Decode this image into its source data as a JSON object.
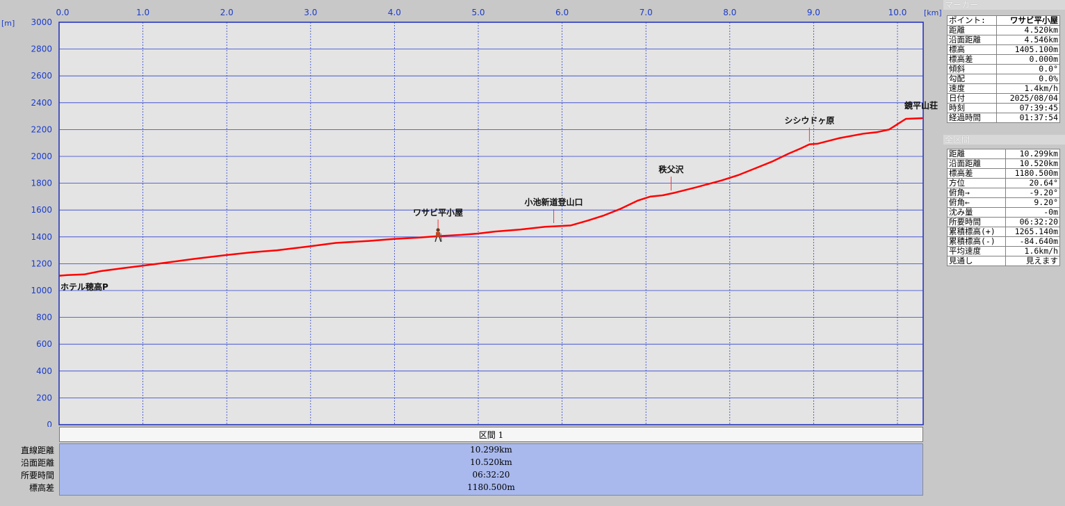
{
  "chart_data": {
    "type": "line",
    "x_unit": "[km]",
    "y_unit": "[m]",
    "xlim": [
      0,
      10.3
    ],
    "ylim": [
      0,
      3000
    ],
    "x_ticks": [
      "0.0",
      "1.0",
      "2.0",
      "3.0",
      "4.0",
      "5.0",
      "6.0",
      "7.0",
      "8.0",
      "9.0",
      "10.0"
    ],
    "y_ticks": [
      "0",
      "200",
      "400",
      "600",
      "800",
      "1000",
      "1200",
      "1400",
      "1600",
      "1800",
      "2000",
      "2200",
      "2400",
      "2600",
      "2800",
      "3000"
    ],
    "grid": true,
    "line_color": "#ff0000",
    "series": [
      {
        "x": [
          0.0,
          0.1,
          0.3,
          0.5,
          0.8,
          1.0,
          1.3,
          1.6,
          2.0,
          2.3,
          2.6,
          3.0,
          3.3,
          3.7,
          4.0,
          4.3,
          4.52,
          4.8,
          5.0,
          5.2,
          5.5,
          5.8,
          5.95,
          6.1,
          6.3,
          6.5,
          6.7,
          6.9,
          7.05,
          7.2,
          7.35,
          7.6,
          7.9,
          8.1,
          8.3,
          8.5,
          8.7,
          8.85,
          8.95,
          9.05,
          9.3,
          9.6,
          9.75,
          9.9,
          10.0,
          10.1,
          10.3
        ],
        "y": [
          1110,
          1115,
          1120,
          1145,
          1170,
          1185,
          1210,
          1235,
          1265,
          1285,
          1300,
          1330,
          1355,
          1370,
          1385,
          1395,
          1405,
          1415,
          1425,
          1440,
          1455,
          1475,
          1480,
          1485,
          1520,
          1560,
          1610,
          1670,
          1700,
          1710,
          1730,
          1770,
          1820,
          1860,
          1910,
          1960,
          2020,
          2060,
          2090,
          2095,
          2135,
          2170,
          2180,
          2200,
          2240,
          2280,
          2285
        ]
      }
    ],
    "waypoints": [
      {
        "name": "ホテル穂高P",
        "x": 0.0,
        "y": 1110
      },
      {
        "name": "ワサビ平小屋",
        "x": 4.52,
        "y": 1405
      },
      {
        "name": "小池新道登山口",
        "x": 5.9,
        "y": 1482
      },
      {
        "name": "秩父沢",
        "x": 7.3,
        "y": 1725
      },
      {
        "name": "シシウドヶ原",
        "x": 8.95,
        "y": 2090
      },
      {
        "name": "鏡平山荘",
        "x": 10.1,
        "y": 2285
      }
    ],
    "marker_x": 4.52
  },
  "marker_panel": {
    "header": "マーカー",
    "rows": [
      {
        "label": "ポイント:",
        "value": "ワサビ平小屋"
      },
      {
        "label": "距離",
        "value": "4.520km"
      },
      {
        "label": "沿面距離",
        "value": "4.546km"
      },
      {
        "label": "標高",
        "value": "1405.100m"
      },
      {
        "label": "標高差",
        "value": "0.000m"
      },
      {
        "label": "傾斜",
        "value": "0.0°"
      },
      {
        "label": "勾配",
        "value": "0.0%"
      },
      {
        "label": "速度",
        "value": "1.4km/h"
      },
      {
        "label": "日付",
        "value": "2025/08/04"
      },
      {
        "label": "時刻",
        "value": "07:39:45"
      },
      {
        "label": "経過時間",
        "value": "01:37:54"
      }
    ]
  },
  "section_panel": {
    "header": "全区間",
    "rows": [
      {
        "label": "距離",
        "value": "10.299km"
      },
      {
        "label": "沿面距離",
        "value": "10.520km"
      },
      {
        "label": "標高差",
        "value": "1180.500m"
      },
      {
        "label": "方位",
        "value": "20.64°"
      },
      {
        "label": "俯角→",
        "value": "-9.20°"
      },
      {
        "label": "俯角←",
        "value": "9.20°"
      },
      {
        "label": "沈み量",
        "value": "-0m"
      },
      {
        "label": "所要時間",
        "value": "06:32:20"
      },
      {
        "label": "累積標高(+)",
        "value": "1265.140m"
      },
      {
        "label": "累積標高(-)",
        "value": "-84.640m"
      },
      {
        "label": "平均速度",
        "value": "1.6km/h"
      },
      {
        "label": "見通し",
        "value": "見えます"
      }
    ]
  },
  "bottom": {
    "section_title": "区間 1",
    "rows": [
      {
        "label": "直線距離",
        "value": "10.299km"
      },
      {
        "label": "沿面距離",
        "value": "10.520km"
      },
      {
        "label": "所要時間",
        "value": "06:32:20"
      },
      {
        "label": "標高差",
        "value": "1180.500m"
      }
    ]
  }
}
